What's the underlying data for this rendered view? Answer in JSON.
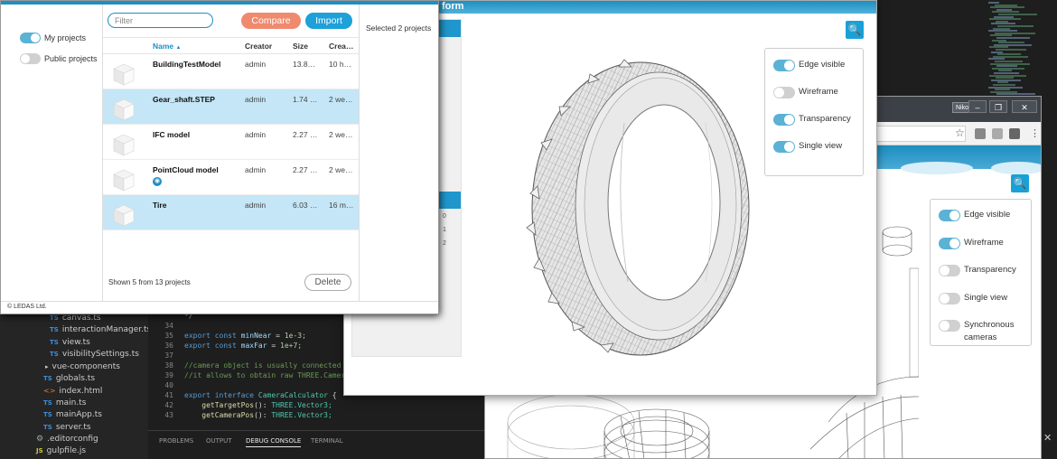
{
  "ide": {
    "explorer_items": [
      {
        "type": "ts",
        "icon": "TS",
        "label": "canvas.ts"
      },
      {
        "type": "ts",
        "icon": "TS",
        "label": "interactionManager.ts"
      },
      {
        "type": "ts",
        "icon": "TS",
        "label": "view.ts"
      },
      {
        "type": "ts",
        "icon": "TS",
        "label": "visibilitySettings.ts"
      },
      {
        "type": "folder",
        "icon": "▸",
        "label": "vue-components"
      },
      {
        "type": "ts",
        "icon": "TS",
        "label": "globals.ts"
      },
      {
        "type": "html",
        "icon": "<>",
        "label": "index.html"
      },
      {
        "type": "ts",
        "icon": "TS",
        "label": "main.ts"
      },
      {
        "type": "ts",
        "icon": "TS",
        "label": "mainApp.ts"
      },
      {
        "type": "ts",
        "icon": "TS",
        "label": "server.ts"
      },
      {
        "type": "config",
        "icon": "⚙",
        "label": ".editorconfig"
      },
      {
        "type": "js",
        "icon": "JS",
        "label": "gulpfile.js"
      }
    ],
    "code": {
      "line_numbers": [
        "34",
        "35",
        "36",
        "37",
        "38",
        "39",
        "40",
        "41",
        "42",
        "43"
      ],
      "line_33": "*/",
      "line_35_kw": "export const",
      "line_35_id": "minNear",
      "line_35_op": "=",
      "line_35_val": "1e-3;",
      "line_36_kw": "export const",
      "line_36_id": "maxFar",
      "line_36_op": "=",
      "line_36_val": "1e+7;",
      "line_38": "//camera object is usually connected",
      "line_39": "//it allows to obtain raw THREE.Camer",
      "line_41_kw": "export interface",
      "line_41_ty": "CameraCalculator",
      "line_41_br": "{",
      "line_42_fn": "getTargetPos",
      "line_42_rest": "(): ",
      "line_42_ty": "THREE.Vector3;",
      "line_43_fn": "getCameraPos",
      "line_43_rest": "(): ",
      "line_43_ty": "THREE.Vector3;"
    },
    "panel_tabs": [
      "PROBLEMS",
      "OUTPUT",
      "DEBUG CONSOLE",
      "TERMINAL"
    ],
    "active_panel_tab": "DEBUG CONSOLE",
    "close_symbol": "✕"
  },
  "browser2": {
    "user_badge": "Nikolay",
    "window_buttons": [
      "–",
      "❐",
      "✕"
    ],
    "star_icon": "☆",
    "menu_icon": "⋮",
    "search_icon": "🔍",
    "view_options": [
      {
        "label": "Edge visible",
        "on": true
      },
      {
        "label": "Wireframe",
        "on": true
      },
      {
        "label": "Transparency",
        "on": false
      },
      {
        "label": "Single view",
        "on": false
      },
      {
        "label": "Synchronous cameras",
        "on": false
      }
    ]
  },
  "browser1": {
    "title_fragment": "form",
    "search_icon": "🔍",
    "side_fragments": [
      "0",
      "1",
      "2"
    ],
    "view_options": [
      {
        "label": "Edge visible",
        "on": true
      },
      {
        "label": "Wireframe",
        "on": false
      },
      {
        "label": "Transparency",
        "on": true
      },
      {
        "label": "Single view",
        "on": true
      }
    ]
  },
  "dialog": {
    "side_toggles": [
      {
        "label": "My projects",
        "on": true
      },
      {
        "label": "Public projects",
        "on": false
      }
    ],
    "filter_placeholder": "Filter",
    "filter_value": "",
    "compare_label": "Compare",
    "import_label": "Import",
    "columns": {
      "name": "Name",
      "sort_indicator": "▲",
      "creator": "Creator",
      "size": "Size",
      "created": "Crea…"
    },
    "rows": [
      {
        "name": "BuildingTestModel",
        "creator": "admin",
        "size": "13.8…",
        "created": "10 h…",
        "selected": false,
        "public": false
      },
      {
        "name": "Gear_shaft.STEP",
        "creator": "admin",
        "size": "1.74 …",
        "created": "2 we…",
        "selected": true,
        "public": false
      },
      {
        "name": "IFC model",
        "creator": "admin",
        "size": "2.27 …",
        "created": "2 we…",
        "selected": false,
        "public": false
      },
      {
        "name": "PointCloud model",
        "creator": "admin",
        "size": "2.27 …",
        "created": "2 we…",
        "selected": false,
        "public": true
      },
      {
        "name": "Tire",
        "creator": "admin",
        "size": "6.03 …",
        "created": "16 m…",
        "selected": true,
        "public": false
      }
    ],
    "public_icon": "◉",
    "shown_text": "Shown 5 from 13 projects",
    "delete_label": "Delete",
    "selected_text": "Selected 2 projects",
    "footer": "© LEDAS Ltd."
  },
  "colors": {
    "accent": "#1ea0d8",
    "compare": "#f08a6e",
    "selected_row": "#c4e6f7",
    "toggle_on": "#5ab2d5",
    "toggle_off": "#d0d0d0"
  }
}
